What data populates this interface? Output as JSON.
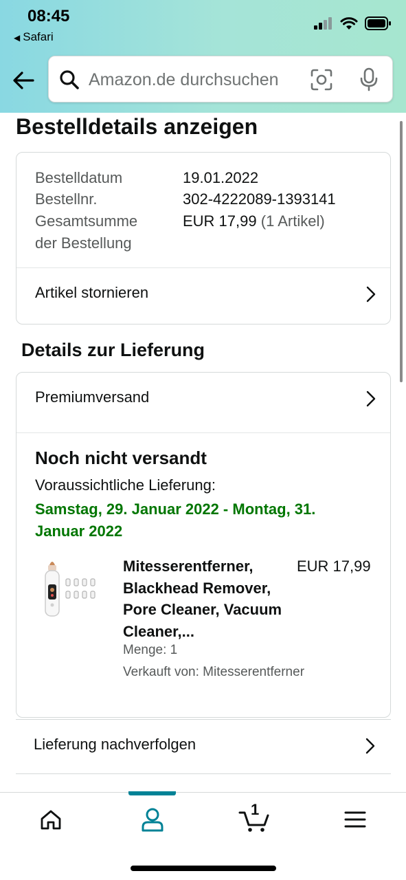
{
  "status_bar": {
    "time": "08:45",
    "back_app": "Safari"
  },
  "search": {
    "placeholder": "Amazon.de durchsuchen"
  },
  "page": {
    "title": "Bestelldetails anzeigen"
  },
  "order_summary": {
    "date_label": "Bestelldatum",
    "date_value": "19.01.2022",
    "number_label": "Bestellnr.",
    "number_value": "302-4222089-1393141",
    "total_label_line1": "Gesamtsumme",
    "total_label_line2": "der Bestellung",
    "total_value": "EUR 17,99",
    "total_items": "(1 Artikel)",
    "cancel_label": "Artikel stornieren"
  },
  "delivery": {
    "section_title": "Details zur Lieferung",
    "shipping_method": "Premiumversand",
    "status": "Noch nicht versandt",
    "expected_label": "Voraussichtliche Lieferung:",
    "expected_dates": "Samstag, 29. Januar 2022 - Montag, 31. Januar 2022",
    "date_color": "#007600"
  },
  "product": {
    "title": "Mitesserentferner, Blackhead Remover, Pore Cleaner, Vacuum Cleaner,...",
    "price": "EUR 17,99",
    "quantity": "Menge: 1",
    "seller": "Verkauft von: Mitesserentferner"
  },
  "tracking": {
    "label": "Lieferung nachverfolgen"
  },
  "bottom_nav": {
    "items": [
      "home-icon",
      "account-icon",
      "cart-icon",
      "menu-icon"
    ],
    "active": "account-icon",
    "cart_count": "1",
    "accent": "#008296"
  }
}
